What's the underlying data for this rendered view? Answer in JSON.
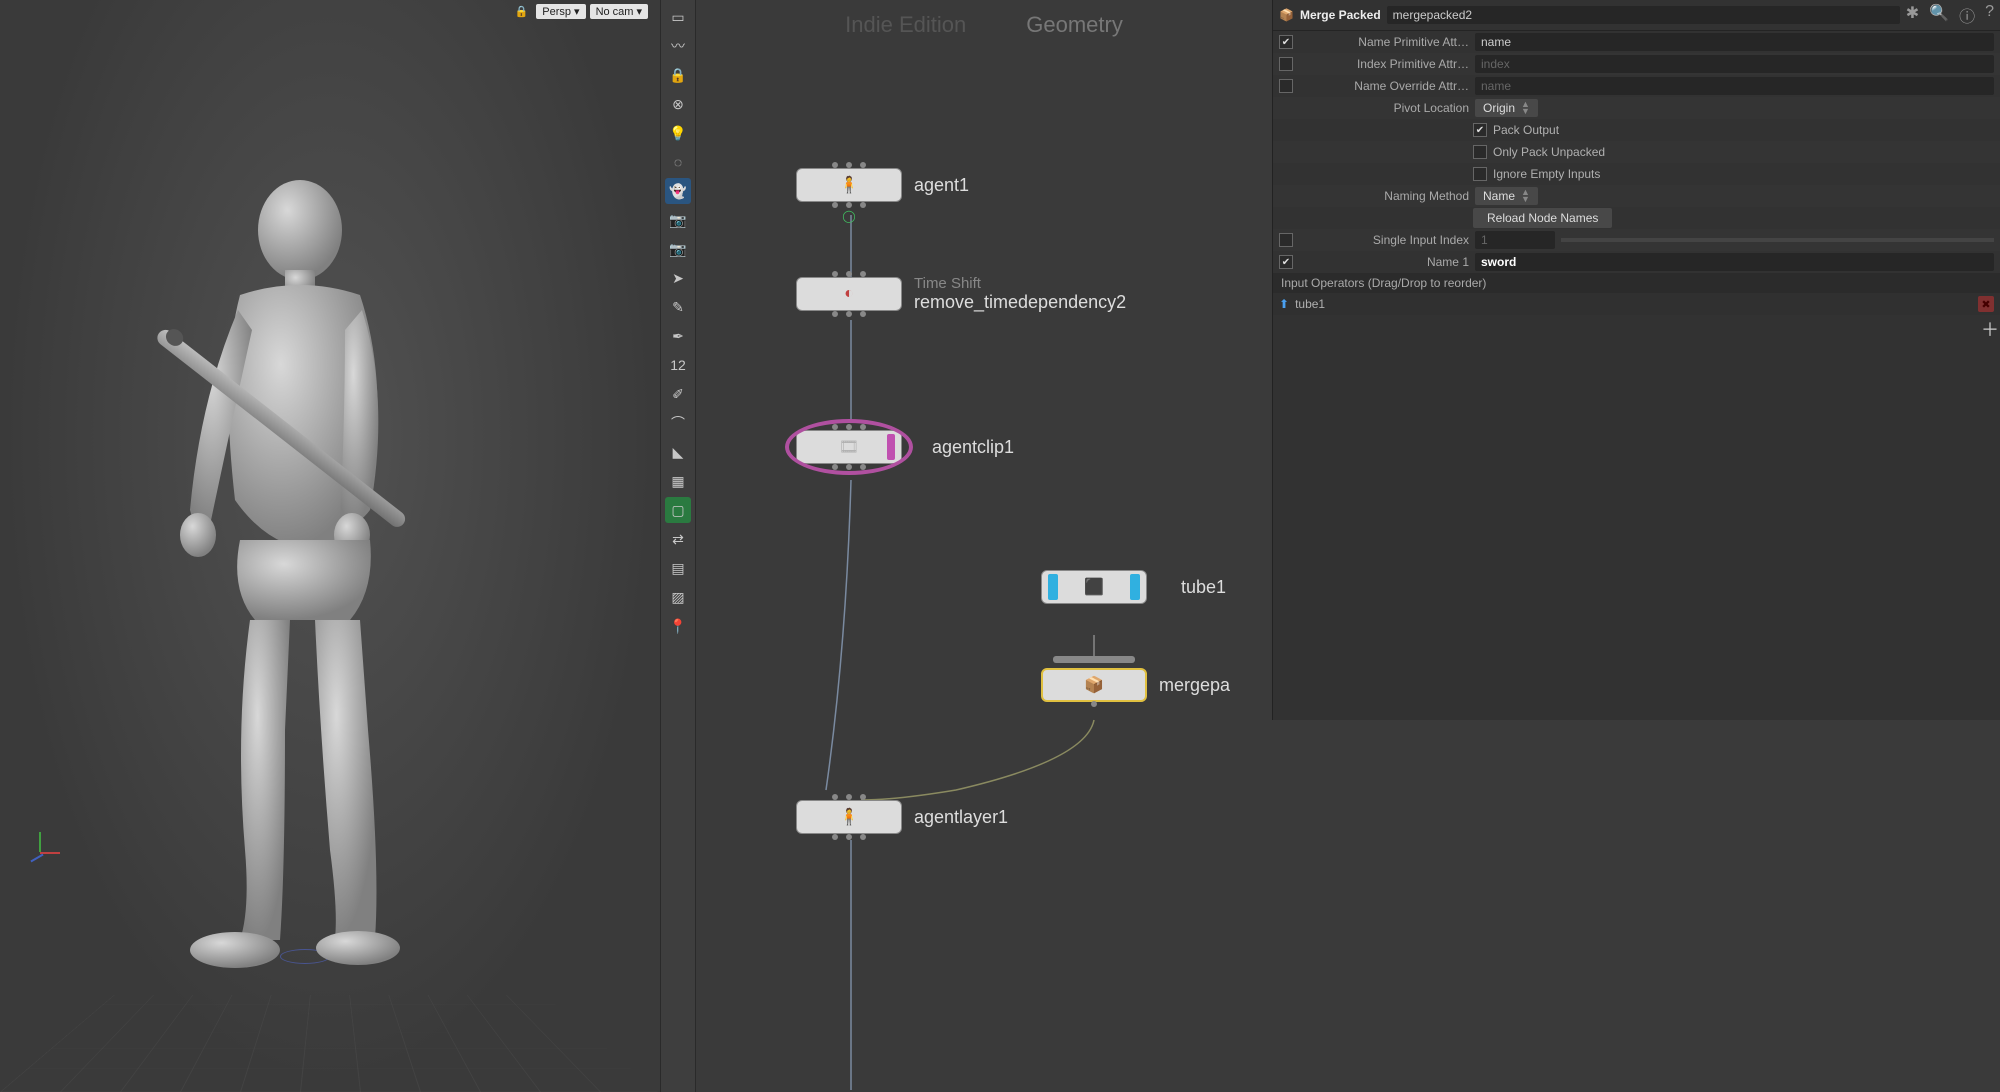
{
  "viewport": {
    "lock_icon": "🔒",
    "camera_tag": "Persp",
    "cam_tag": "No cam"
  },
  "toolbar": {
    "icons": [
      {
        "name": "select-icon",
        "glyph": "▭"
      },
      {
        "name": "lasso-icon",
        "glyph": "〰"
      },
      {
        "name": "lock-icon",
        "glyph": "🔒"
      },
      {
        "name": "sphere-icon",
        "glyph": "⊗"
      },
      {
        "name": "bulb-on-icon",
        "glyph": "💡"
      },
      {
        "name": "bulb-off-icon",
        "glyph": "◌"
      },
      {
        "name": "ghost-icon",
        "glyph": "👻",
        "active": true
      },
      {
        "name": "camera-icon",
        "glyph": "📷"
      },
      {
        "name": "camera-lock-icon",
        "glyph": "📷"
      },
      {
        "name": "arrow-icon",
        "glyph": "➤"
      },
      {
        "name": "brush-icon",
        "glyph": "✎"
      },
      {
        "name": "pen-icon",
        "glyph": "✒"
      },
      {
        "name": "measure-icon",
        "glyph": "12"
      },
      {
        "name": "sweep-icon",
        "glyph": "✐"
      },
      {
        "name": "curve-icon",
        "glyph": "⌒"
      },
      {
        "name": "tag-icon",
        "glyph": "◣"
      },
      {
        "name": "checker-icon",
        "glyph": "▦"
      },
      {
        "name": "box-icon",
        "glyph": "▢",
        "green": true
      },
      {
        "name": "link-icon",
        "glyph": "⇄"
      },
      {
        "name": "image-icon",
        "glyph": "▤"
      },
      {
        "name": "render-icon",
        "glyph": "▨"
      },
      {
        "name": "pin-icon",
        "glyph": "📍"
      }
    ]
  },
  "network": {
    "left_title": "Indie Edition",
    "right_title": "Geometry",
    "nodes": {
      "agent1": {
        "label": "agent1"
      },
      "remove_td": {
        "label": "remove_timedependency2",
        "sublabel": "Time Shift"
      },
      "agentclip1": {
        "label": "agentclip1"
      },
      "tube1": {
        "label": "tube1"
      },
      "mergepacked": {
        "label": "mergepa"
      },
      "agentlayer1": {
        "label": "agentlayer1"
      }
    }
  },
  "params": {
    "node_type": "Merge Packed",
    "node_name": "mergepacked2",
    "name_prim_attr": {
      "label": "Name Primitive Att…",
      "checked": true,
      "value": "name"
    },
    "index_prim_attr": {
      "label": "Index Primitive Attr…",
      "checked": false,
      "value": "index"
    },
    "name_override_attr": {
      "label": "Name Override Attr…",
      "checked": false,
      "value": "name"
    },
    "pivot_location": {
      "label": "Pivot Location",
      "value": "Origin"
    },
    "pack_output": {
      "label": "Pack Output",
      "checked": true
    },
    "only_pack_unpacked": {
      "label": "Only Pack Unpacked",
      "checked": false
    },
    "ignore_empty_inputs": {
      "label": "Ignore Empty Inputs",
      "checked": false
    },
    "naming_method": {
      "label": "Naming Method",
      "value": "Name"
    },
    "reload_button": "Reload Node Names",
    "single_input_index": {
      "label": "Single Input Index",
      "checked": false,
      "value": "1"
    },
    "name1": {
      "label": "Name 1",
      "checked": true,
      "value": "sword"
    },
    "input_ops_header": "Input Operators (Drag/Drop to reorder)",
    "input_op_1": "tube1"
  }
}
